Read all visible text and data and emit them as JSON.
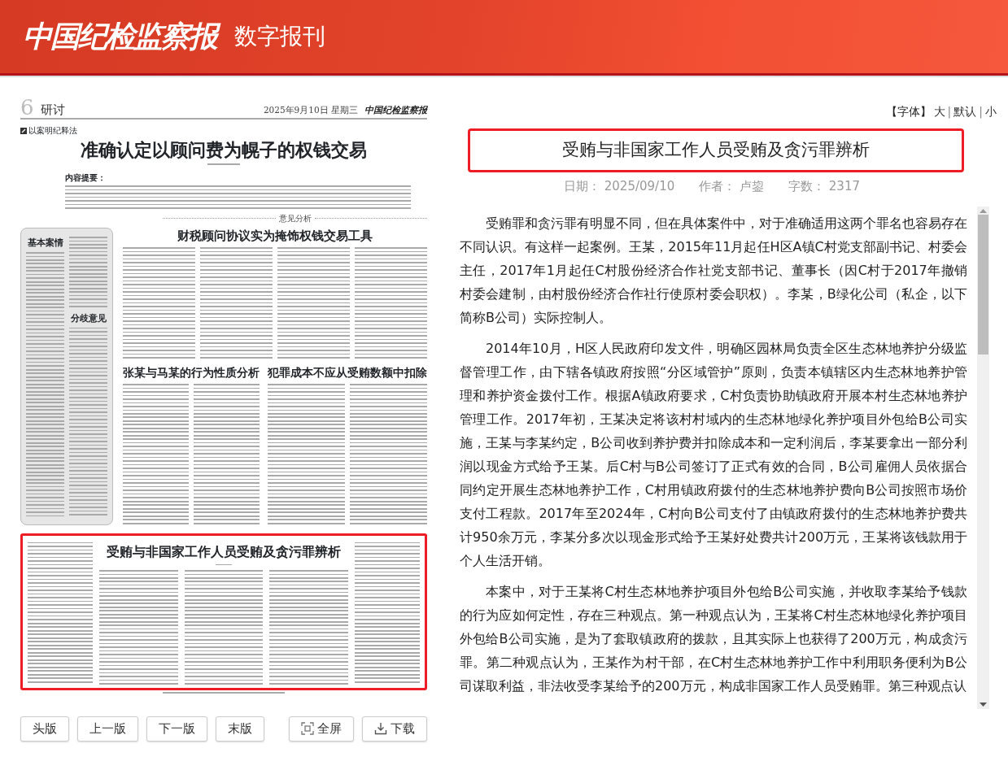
{
  "header": {
    "logo": "中国纪检监察报",
    "subtitle": "数字报刊"
  },
  "newspaper_page": {
    "page_number": "6",
    "section": "研讨",
    "date": "2025年9月10日  星期三",
    "masthead": "中国纪检监察报",
    "column_tag": "以案明纪释法",
    "headline": "准确认定以顾问费为幌子的权钱交易",
    "summary_label": "内容提要：",
    "divider_label": "意见分析",
    "sidebar_headings": [
      "基本案情",
      "分歧意见"
    ],
    "subheads": [
      "财税顾问协议实为掩饰权钱交易工具",
      "张某与马某的行为性质分析",
      "犯罪成本不应从受贿数额中扣除"
    ],
    "highlighted_article": {
      "headline": "受贿与非国家工作人员受贿及贪污罪辨析",
      "selected": true
    }
  },
  "page_nav": [
    {
      "label": "头版"
    },
    {
      "label": "上一版"
    },
    {
      "label": "下一版"
    },
    {
      "label": "末版"
    }
  ],
  "page_tools": [
    {
      "label": "全屏",
      "kind": "fullscreen"
    },
    {
      "label": "下载",
      "kind": "download"
    }
  ],
  "font_size": [
    {
      "kind": "label",
      "text": "【字体】"
    },
    {
      "kind": "link",
      "text": "大"
    },
    {
      "kind": "separator",
      "text": "|"
    },
    {
      "kind": "link",
      "text": "默认"
    },
    {
      "kind": "separator",
      "text": "|"
    },
    {
      "kind": "link",
      "text": "小"
    }
  ],
  "article": {
    "title": "受贿与非国家工作人员受贿及贪污罪辨析",
    "meta": [
      {
        "label": "日期：",
        "value": "2025/09/10"
      },
      {
        "label": "作者：",
        "value": "卢鋆"
      },
      {
        "label": "字数：",
        "value": "2317"
      }
    ],
    "paragraphs": [
      "受贿罪和贪污罪有明显不同，但在具体案件中，对于准确适用这两个罪名也容易存在不同认识。有这样一起案例。王某，2015年11月起任H区A镇C村党支部副书记、村委会主任，2017年1月起任C村股份经济合作社党支部书记、董事长（因C村于2017年撤销村委会建制，由村股份经济合作社行使原村委会职权）。李某，B绿化公司（私企，以下简称B公司）实际控制人。",
      "2014年10月，H区人民政府印发文件，明确区园林局负责全区生态林地养护分级监督管理工作，由下辖各镇政府按照“分区域管护”原则，负责本镇辖区内生态林地养护管理和养护资金拨付工作。根据A镇政府要求，C村负责协助镇政府开展本村生态林地养护管理工作。2017年初，王某决定将该村村域内的生态林地绿化养护项目外包给B公司实施，王某与李某约定，B公司收到养护费并扣除成本和一定利润后，李某要拿出一部分利润以现金方式给予王某。后C村与B公司签订了正式有效的合同，B公司雇佣人员依据合同约定开展生态林地养护工作，C村用镇政府拨付的生态林地养护费向B公司按照市场价支付工程款。2017年至2024年，C村向B公司支付了由镇政府拨付的生态林地养护费共计950余万元，李某分多次以现金形式给予王某好处费共计200万元，王某将该钱款用于个人生活开销。",
      "本案中，对于王某将C村生态林地养护项目外包给B公司实施，并收取李某给予钱款的行为应如何定性，存在三种观点。第一种观点认为，王某将C村生态林地绿化养护项目外包给B公司实施，是为了套取镇政府的拨款，且其实际上也获得了200万元，构成贪污罪。第二种观点认为，王某作为村干部，在C村生态林地养护工作中利用职务便利为B公司谋取利益，非法收受李某给予的200万元，构成非国家工作人员受贿罪。第三种观点认"
    ]
  }
}
